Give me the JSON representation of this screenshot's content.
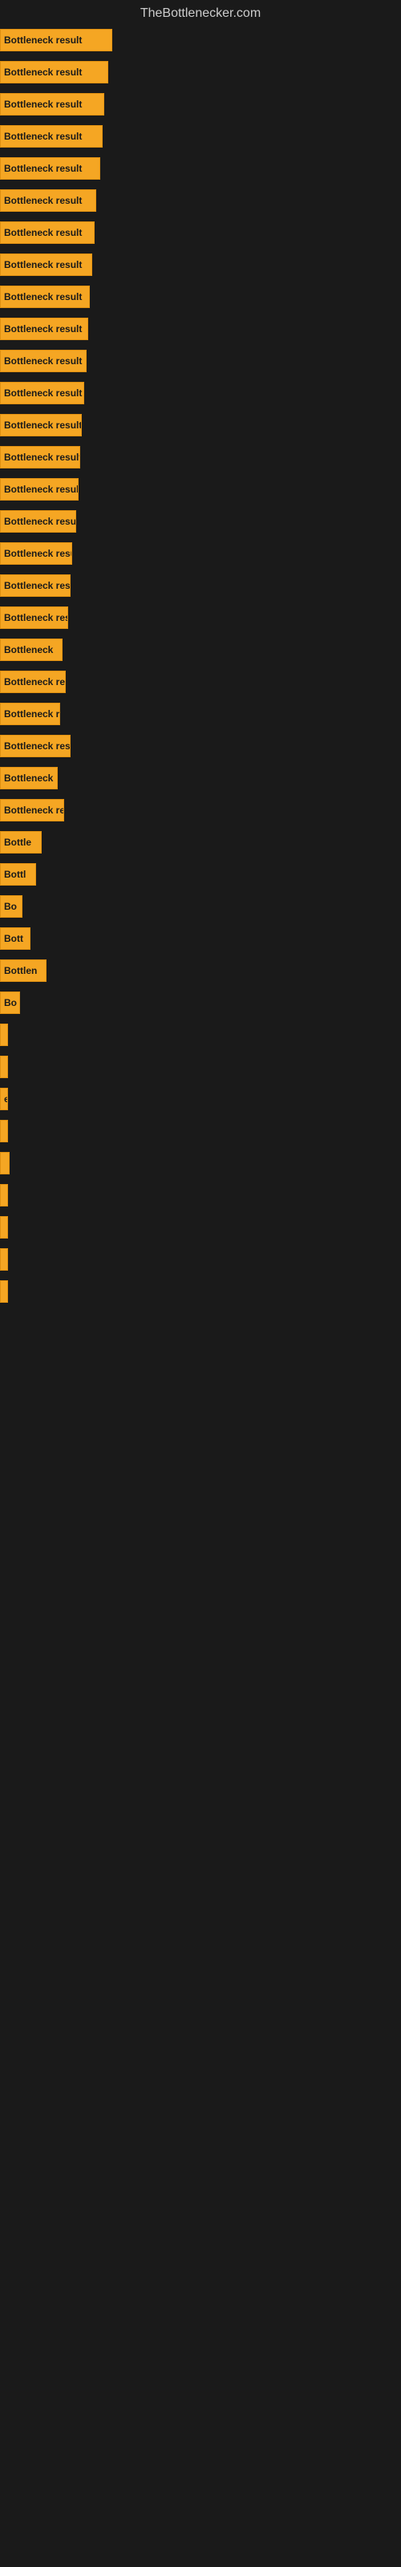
{
  "site": {
    "title": "TheBottlenecker.com"
  },
  "bars": [
    {
      "label": "Bottleneck result",
      "width": 140
    },
    {
      "label": "Bottleneck result",
      "width": 135
    },
    {
      "label": "Bottleneck result",
      "width": 130
    },
    {
      "label": "Bottleneck result",
      "width": 128
    },
    {
      "label": "Bottleneck result",
      "width": 125
    },
    {
      "label": "Bottleneck result",
      "width": 120
    },
    {
      "label": "Bottleneck result",
      "width": 118
    },
    {
      "label": "Bottleneck result",
      "width": 115
    },
    {
      "label": "Bottleneck result",
      "width": 112
    },
    {
      "label": "Bottleneck result",
      "width": 110
    },
    {
      "label": "Bottleneck result",
      "width": 108
    },
    {
      "label": "Bottleneck result",
      "width": 105
    },
    {
      "label": "Bottleneck result",
      "width": 102
    },
    {
      "label": "Bottleneck result",
      "width": 100
    },
    {
      "label": "Bottleneck result",
      "width": 98
    },
    {
      "label": "Bottleneck result",
      "width": 95
    },
    {
      "label": "Bottleneck resu",
      "width": 90
    },
    {
      "label": "Bottleneck result",
      "width": 88
    },
    {
      "label": "Bottleneck res",
      "width": 85
    },
    {
      "label": "Bottleneck",
      "width": 78
    },
    {
      "label": "Bottleneck res",
      "width": 82
    },
    {
      "label": "Bottleneck re",
      "width": 75
    },
    {
      "label": "Bottleneck resu",
      "width": 88
    },
    {
      "label": "Bottleneck",
      "width": 72
    },
    {
      "label": "Bottleneck res",
      "width": 80
    },
    {
      "label": "Bottle",
      "width": 52
    },
    {
      "label": "Bottl",
      "width": 45
    },
    {
      "label": "Bo",
      "width": 28
    },
    {
      "label": "Bott",
      "width": 38
    },
    {
      "label": "Bottlen",
      "width": 58
    },
    {
      "label": "Bo",
      "width": 25
    },
    {
      "label": "",
      "width": 8
    },
    {
      "label": "",
      "width": 6
    },
    {
      "label": "e",
      "width": 10
    },
    {
      "label": "",
      "width": 5
    },
    {
      "label": "",
      "width": 12
    },
    {
      "label": "",
      "width": 10
    },
    {
      "label": "",
      "width": 8
    },
    {
      "label": "",
      "width": 6
    },
    {
      "label": "",
      "width": 5
    }
  ]
}
